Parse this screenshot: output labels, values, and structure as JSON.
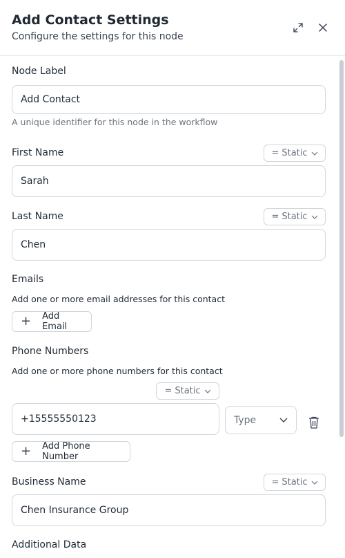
{
  "header": {
    "title": "Add Contact Settings",
    "subtitle": "Configure the settings for this node"
  },
  "node_label": {
    "label": "Node Label",
    "value": "Add Contact",
    "help": "A unique identifier for this node in the workflow"
  },
  "first_name": {
    "label": "First Name",
    "mode": "Static",
    "value": "Sarah"
  },
  "last_name": {
    "label": "Last Name",
    "mode": "Static",
    "value": "Chen"
  },
  "emails": {
    "label": "Emails",
    "help": "Add one or more email addresses for this contact",
    "add_label": "Add Email"
  },
  "phones": {
    "label": "Phone Numbers",
    "help": "Add one or more phone numbers for this contact",
    "mode": "Static",
    "value": "+15555550123",
    "type_placeholder": "Type",
    "add_label": "Add Phone Number"
  },
  "business_name": {
    "label": "Business Name",
    "mode": "Static",
    "value": "Chen Insurance Group"
  },
  "additional_data": {
    "label": "Additional Data"
  },
  "icons": {
    "expand": "expand-icon",
    "close": "close-icon",
    "plus": "plus-icon",
    "chevron": "chevron-down-icon",
    "trash": "trash-icon",
    "equals": "equals-icon"
  }
}
